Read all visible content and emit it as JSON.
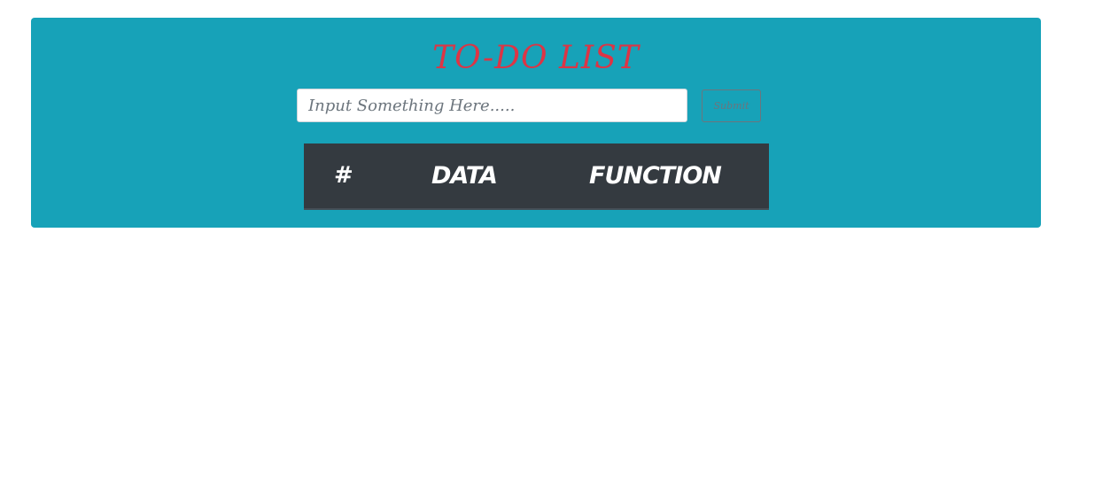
{
  "app": {
    "title": "TO-DO LIST"
  },
  "form": {
    "input_placeholder": "Input Something Here.....",
    "input_value": "",
    "submit_label": "Submit"
  },
  "table": {
    "columns": [
      "#",
      "DATA",
      "FUNCTION"
    ],
    "rows": []
  },
  "colors": {
    "panel_background": "#17a2b8",
    "title": "#dc3545",
    "table_header": "#343a40",
    "page_background": "#ffffff"
  }
}
